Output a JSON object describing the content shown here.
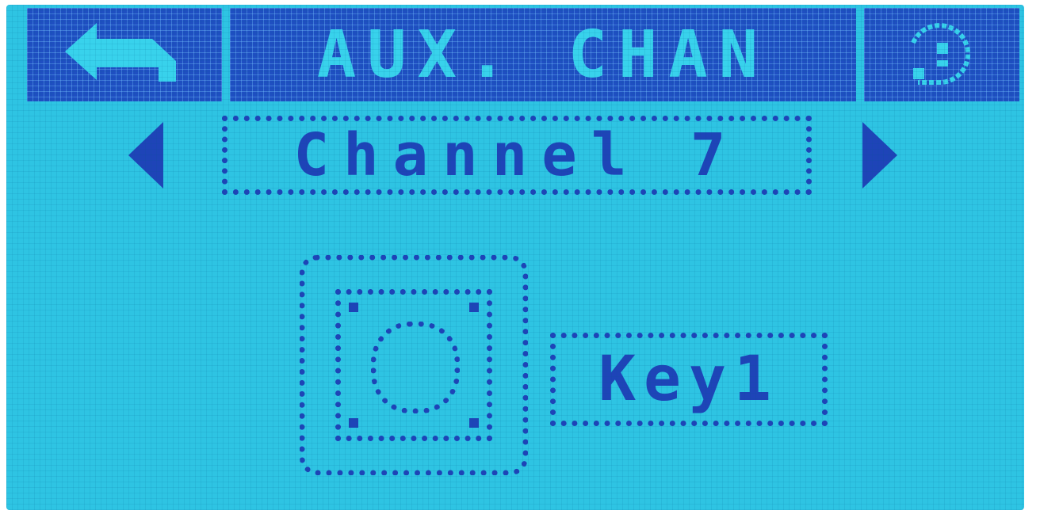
{
  "header": {
    "title": "AUX. CHAN",
    "back_icon": "back-arrow-icon",
    "help_icon": "help-icon"
  },
  "channel_selector": {
    "label": "Channel 7",
    "prev_icon": "triangle-left-icon",
    "next_icon": "triangle-right-icon"
  },
  "key": {
    "icon": "key-button-icon",
    "label": "Key1"
  },
  "colors": {
    "background": "#2ec4e3",
    "pixels": "#1e44b8",
    "header_fill": "#1f4fc2"
  }
}
